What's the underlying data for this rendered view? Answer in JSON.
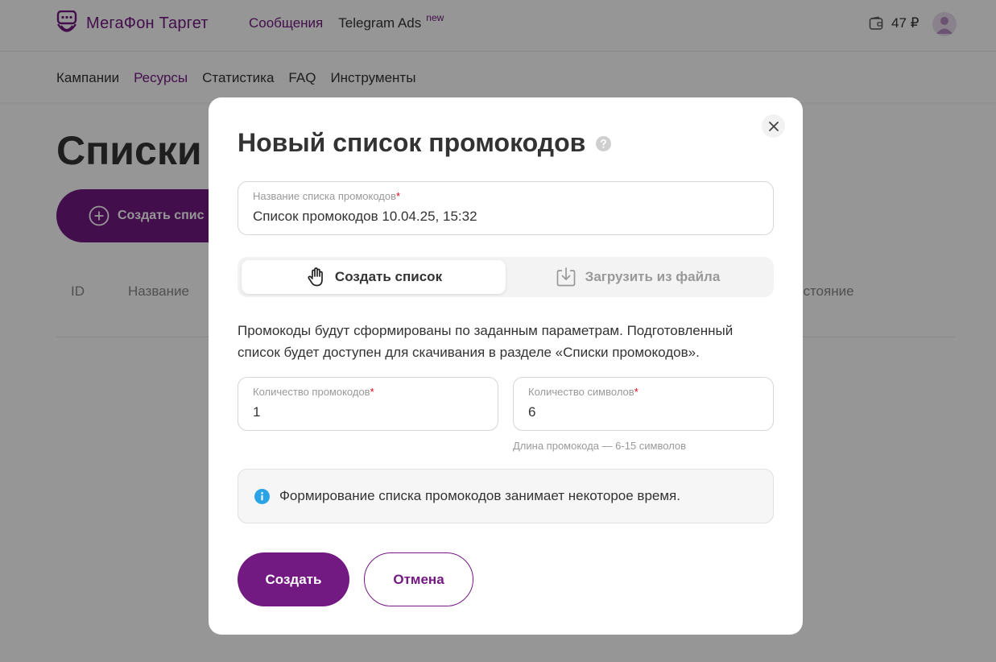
{
  "header": {
    "logo_text": "МегаФон Таргет",
    "nav": [
      {
        "label": "Сообщения"
      },
      {
        "label": "Telegram Ads",
        "badge": "new"
      }
    ],
    "balance": "47 ₽"
  },
  "subnav": {
    "items": [
      "Кампании",
      "Ресурсы",
      "Статистика",
      "FAQ",
      "Инструменты"
    ]
  },
  "page": {
    "title": "Списки",
    "create_button": "Создать спис",
    "table_columns": [
      "ID",
      "Название",
      "остояние"
    ]
  },
  "modal": {
    "title": "Новый список промокодов",
    "name_field": {
      "label": "Название списка промокодов",
      "required_mark": "*",
      "value": "Список промокодов 10.04.25, 15:32"
    },
    "tabs": [
      {
        "label": "Создать список",
        "icon": "hand-icon",
        "active": true
      },
      {
        "label": "Загрузить из файла",
        "icon": "download-icon",
        "active": false
      }
    ],
    "description": "Промокоды будут сформированы по заданным параметрам. Подготовленный список будет доступен для скачивания в разделе «Списки промокодов».",
    "count_field": {
      "label": "Количество промокодов",
      "required_mark": "*",
      "value": "1"
    },
    "chars_field": {
      "label": "Количество символов",
      "required_mark": "*",
      "value": "6"
    },
    "chars_hint": "Длина промокода — 6-15 символов",
    "info_text": "Формирование списка промокодов занимает некоторое время.",
    "submit_label": "Создать",
    "cancel_label": "Отмена"
  },
  "colors": {
    "brand": "#731982",
    "info": "#2aa4e6",
    "required": "#e1001b"
  }
}
